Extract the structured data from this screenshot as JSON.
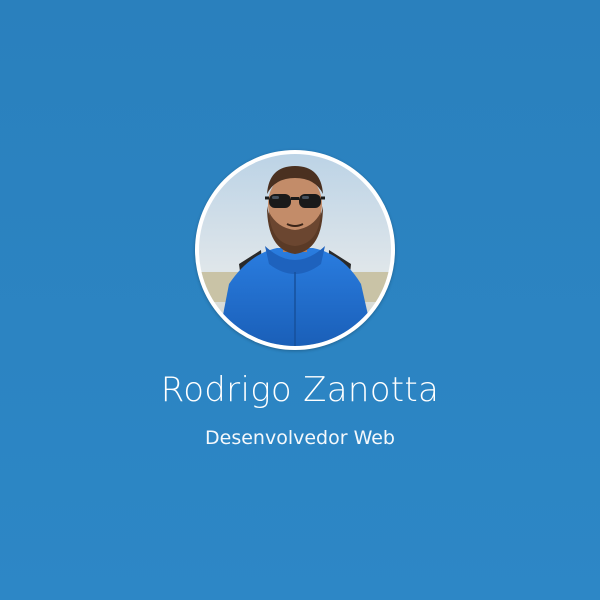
{
  "profile": {
    "name": "Rodrigo Zanotta",
    "role": "Desenvolvedor Web"
  },
  "colors": {
    "background": "#2a80bd",
    "avatar_border": "#ffffff",
    "text": "#ffffff",
    "hoodie": "#1f6fd1"
  }
}
